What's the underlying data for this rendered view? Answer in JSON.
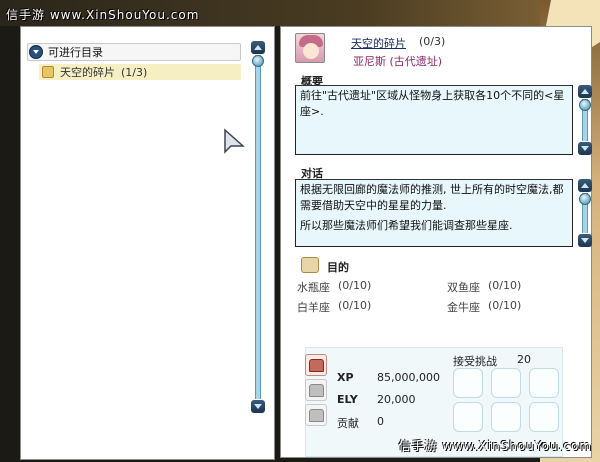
{
  "watermark": {
    "top": "信手游 www.XinShouYou.com",
    "bottom": "信手游 www.XinShouYou.com"
  },
  "quest_list": {
    "category_label": "可进行目录",
    "items": [
      {
        "title": "天空的碎片",
        "progress": "(1/3)"
      }
    ]
  },
  "quest_detail": {
    "title": "天空的碎片",
    "progress": "(0/3)",
    "giver": "亚尼斯 (古代遗址)",
    "summary_label": "概要",
    "summary_text": "前往\"古代遗址\"区域从怪物身上获取各10个不同的<星座>.",
    "dialog_label": "对话",
    "dialog_lines": [
      "根据无限回廊的魔法师的推测, 世上所有的时空魔法,都需要借助天空中的星星的力量.",
      "所以那些魔法师们希望我们能调查那些星座."
    ],
    "goal_label": "目的",
    "goals": [
      {
        "name": "水瓶座",
        "value": "(0/10)"
      },
      {
        "name": "双鱼座",
        "value": "(0/10)"
      },
      {
        "name": "白羊座",
        "value": "(0/10)"
      },
      {
        "name": "金牛座",
        "value": "(0/10)"
      }
    ],
    "rewards": {
      "xp_label": "XP",
      "xp_value": "85,000,000",
      "ely_label": "ELY",
      "ely_value": "20,000",
      "contribution_label": "贡献",
      "contribution_value": "0",
      "challenge_label": "接受挑战",
      "challenge_value": "20"
    }
  },
  "colors": {
    "accent": "#2d4f7a",
    "textbox_bg": "#e8f7fb",
    "highlight": "#f6efc4"
  }
}
